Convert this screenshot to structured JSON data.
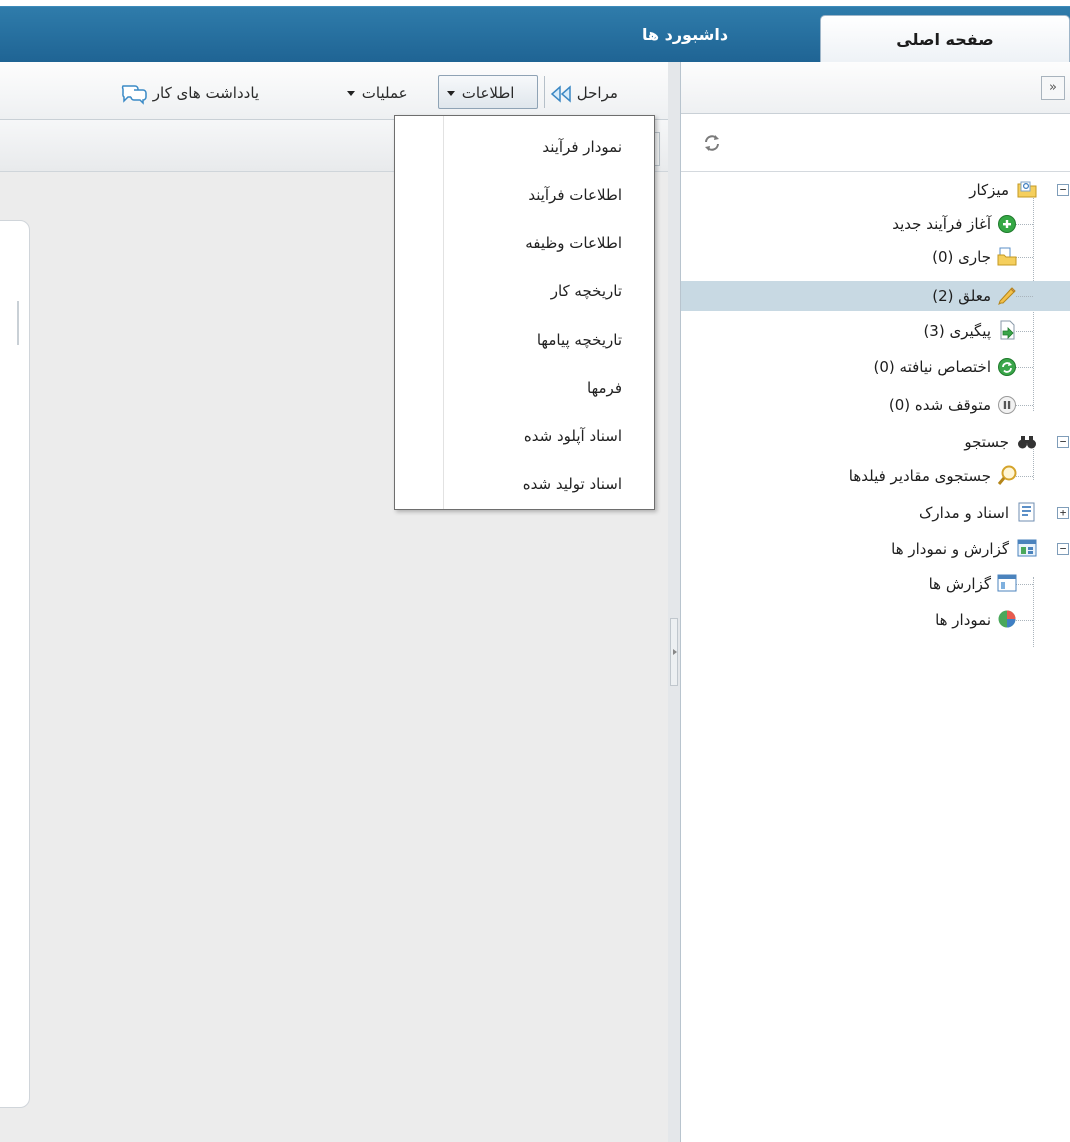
{
  "tabs": [
    {
      "label": "صفحه اصلی",
      "active": true
    },
    {
      "label": "داشبورد ها",
      "active": false
    }
  ],
  "toolbar": {
    "steps_label": "مراحل",
    "info_label": "اطلاعات",
    "operations_label": "عملیات",
    "notes_label": "یادداشت های کار"
  },
  "collapse_button": "»",
  "info_menu": {
    "items": [
      {
        "label": "نمودار فرآیند"
      },
      {
        "label": "اطلاعات فرآیند"
      },
      {
        "label": "اطلاعات وظیفه"
      },
      {
        "label": "تاریخچه کار"
      },
      {
        "label": "تاریخچه پیامها"
      },
      {
        "label": "فرمها"
      },
      {
        "label": "اسناد آپلود شده"
      },
      {
        "label": "اسناد تولید شده"
      }
    ]
  },
  "tree": {
    "nodes": [
      {
        "label": "میزکار",
        "icon": "folder-icon",
        "expander": "−"
      },
      {
        "label": "آغاز فرآیند جدید",
        "icon": "add-circle-icon"
      },
      {
        "label": "جاری (0)",
        "icon": "document-folder-icon"
      },
      {
        "label": "معلق (2)",
        "icon": "pencil-icon",
        "selected": true
      },
      {
        "label": "پیگیری (3)",
        "icon": "forward-document-icon"
      },
      {
        "label": "اختصاص نیافته (0)",
        "icon": "refresh-green-icon"
      },
      {
        "label": "متوقف شده (0)",
        "icon": "pause-icon"
      },
      {
        "label": "جستجو",
        "icon": "binoculars-icon",
        "expander": "−"
      },
      {
        "label": "جستجوی مقادیر فیلدها",
        "icon": "magnifier-icon"
      },
      {
        "label": "اسناد و مدارک",
        "icon": "document-list-icon",
        "expander": "+"
      },
      {
        "label": "گزارش و نمودار ها",
        "icon": "report-icon",
        "expander": "−"
      },
      {
        "label": "گزارش ها",
        "icon": "report-table-icon"
      },
      {
        "label": "نمودار ها",
        "icon": "pie-chart-icon"
      }
    ]
  },
  "colors": {
    "header_blue": "#2a74a3",
    "selected_row": "#c8d9e3"
  }
}
